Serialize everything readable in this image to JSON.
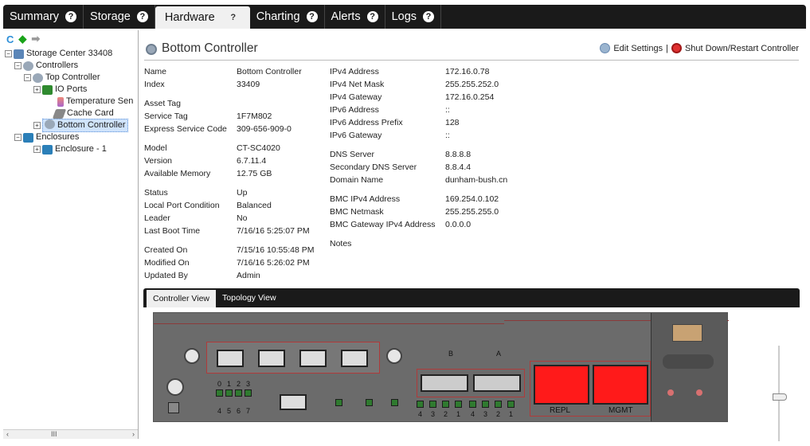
{
  "tabs": [
    {
      "label": "Summary",
      "active": false
    },
    {
      "label": "Storage",
      "active": false
    },
    {
      "label": "Hardware",
      "active": true
    },
    {
      "label": "Charting",
      "active": false
    },
    {
      "label": "Alerts",
      "active": false
    },
    {
      "label": "Logs",
      "active": false
    }
  ],
  "tab_help_glyph": "?",
  "nav": {
    "refresh": "C",
    "back": "◆",
    "forward": "➡"
  },
  "tree": {
    "root": "Storage Center 33408",
    "controllers": "Controllers",
    "top_controller": "Top Controller",
    "io_ports": "IO Ports",
    "temperature": "Temperature Sen",
    "cache_card": "Cache Card",
    "bottom_controller": "Bottom Controller",
    "enclosures": "Enclosures",
    "enclosure1": "Enclosure - 1",
    "scroll_mark": "III"
  },
  "header": {
    "title": "Bottom Controller",
    "edit_settings": "Edit Settings",
    "separator": "|",
    "shutdown": "Shut Down/Restart Controller"
  },
  "props_left": [
    [
      {
        "label": "Name",
        "value": "Bottom Controller"
      },
      {
        "label": "Index",
        "value": "33409"
      }
    ],
    [
      {
        "label": "Asset Tag",
        "value": ""
      },
      {
        "label": "Service Tag",
        "value": "1F7M802"
      },
      {
        "label": "Express Service Code",
        "value": "309-656-909-0"
      }
    ],
    [
      {
        "label": "Model",
        "value": "CT-SC4020"
      },
      {
        "label": "Version",
        "value": "6.7.11.4"
      },
      {
        "label": "Available Memory",
        "value": "12.75 GB"
      }
    ],
    [
      {
        "label": "Status",
        "value": "Up"
      },
      {
        "label": "Local Port Condition",
        "value": "Balanced"
      },
      {
        "label": "Leader",
        "value": "No"
      },
      {
        "label": "Last Boot Time",
        "value": "7/16/16 5:25:07 PM"
      }
    ],
    [
      {
        "label": "Created On",
        "value": "7/15/16 10:55:48 PM"
      },
      {
        "label": "Modified On",
        "value": "7/16/16 5:26:02 PM"
      },
      {
        "label": "Updated By",
        "value": "Admin"
      }
    ]
  ],
  "props_right": [
    [
      {
        "label": "IPv4 Address",
        "value": "172.16.0.78"
      },
      {
        "label": "IPv4 Net Mask",
        "value": "255.255.252.0"
      },
      {
        "label": "IPv4 Gateway",
        "value": "172.16.0.254"
      },
      {
        "label": "IPv6 Address",
        "value": "::"
      },
      {
        "label": "IPv6 Address Prefix",
        "value": "128"
      },
      {
        "label": "IPv6 Gateway",
        "value": "::"
      }
    ],
    [
      {
        "label": "DNS Server",
        "value": "8.8.8.8"
      },
      {
        "label": "Secondary DNS Server",
        "value": "8.8.4.4"
      },
      {
        "label": "Domain Name",
        "value": "dunham-bush.cn"
      }
    ],
    [
      {
        "label": "BMC IPv4 Address",
        "value": "169.254.0.102"
      },
      {
        "label": "BMC Netmask",
        "value": "255.255.255.0"
      },
      {
        "label": "BMC Gateway IPv4 Address",
        "value": "0.0.0.0"
      }
    ],
    [
      {
        "label": "Notes",
        "value": ""
      }
    ]
  ],
  "view_tabs": [
    {
      "label": "Controller View",
      "active": true
    },
    {
      "label": "Topology View",
      "active": false
    }
  ],
  "hardware": {
    "ports_top_labels": [
      "0",
      "1",
      "2",
      "3"
    ],
    "ports_bottom_labels": [
      "4",
      "5",
      "6",
      "7"
    ],
    "sfp_labels": [
      "B",
      "A"
    ],
    "red_port_labels": [
      "REPL",
      "MGMT"
    ],
    "small_labels": [
      "4",
      "3",
      "2",
      "1",
      "4",
      "3",
      "2",
      "1"
    ]
  },
  "colors": {
    "tab_bg": "#1a1a1a",
    "active_tab": "#f0f0f0",
    "selection": "#cfe3fb",
    "port_red": "#ff1a1a",
    "chassis": "#6b6b6b"
  }
}
